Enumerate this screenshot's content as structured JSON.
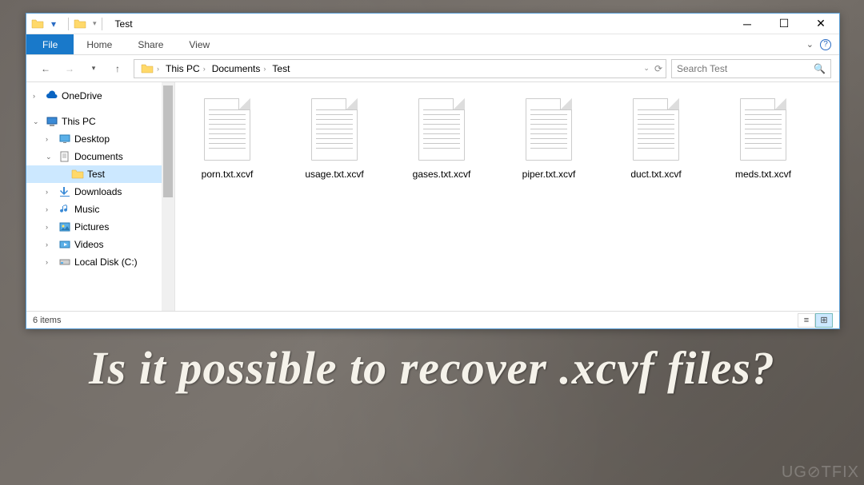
{
  "window": {
    "title": "Test"
  },
  "menubar": {
    "file": "File",
    "tabs": [
      "Home",
      "Share",
      "View"
    ]
  },
  "nav": {
    "breadcrumbs": [
      "This PC",
      "Documents",
      "Test"
    ]
  },
  "search": {
    "placeholder": "Search Test"
  },
  "sidebar": {
    "items": [
      {
        "label": "OneDrive",
        "indent": 0,
        "chev": "›",
        "icon": "cloud",
        "selected": false
      },
      {
        "label": "This PC",
        "indent": 0,
        "chev": "⌄",
        "icon": "pc",
        "selected": false
      },
      {
        "label": "Desktop",
        "indent": 1,
        "chev": "›",
        "icon": "desktop",
        "selected": false
      },
      {
        "label": "Documents",
        "indent": 1,
        "chev": "⌄",
        "icon": "documents",
        "selected": false
      },
      {
        "label": "Test",
        "indent": 2,
        "chev": "",
        "icon": "folder",
        "selected": true
      },
      {
        "label": "Downloads",
        "indent": 1,
        "chev": "›",
        "icon": "downloads",
        "selected": false
      },
      {
        "label": "Music",
        "indent": 1,
        "chev": "›",
        "icon": "music",
        "selected": false
      },
      {
        "label": "Pictures",
        "indent": 1,
        "chev": "›",
        "icon": "pictures",
        "selected": false
      },
      {
        "label": "Videos",
        "indent": 1,
        "chev": "›",
        "icon": "videos",
        "selected": false
      },
      {
        "label": "Local Disk (C:)",
        "indent": 1,
        "chev": "›",
        "icon": "disk",
        "selected": false
      }
    ]
  },
  "files": [
    {
      "name": "porn.txt.xcvf"
    },
    {
      "name": "usage.txt.xcvf"
    },
    {
      "name": "gases.txt.xcvf"
    },
    {
      "name": "piper.txt.xcvf"
    },
    {
      "name": "duct.txt.xcvf"
    },
    {
      "name": "meds.txt.xcvf"
    }
  ],
  "status": {
    "count": "6 items"
  },
  "caption": "Is it possible to recover .xcvf files?",
  "watermark": "UG⊘TFIX"
}
